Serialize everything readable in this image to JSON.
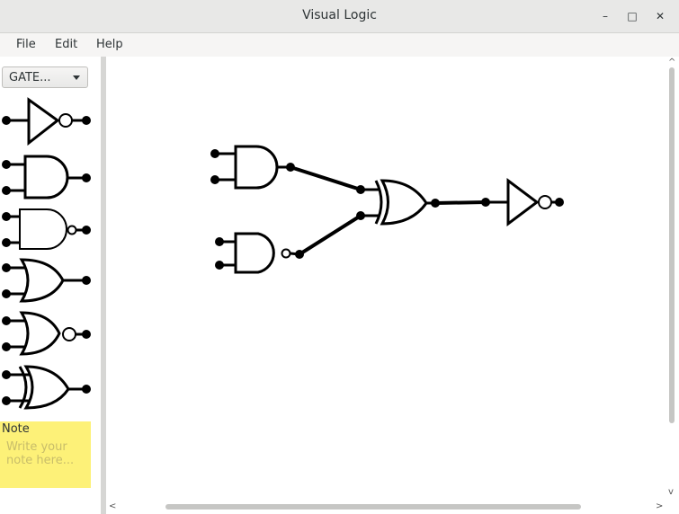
{
  "window": {
    "title": "Visual Logic",
    "minimize_glyph": "–",
    "maximize_glyph": "□",
    "close_glyph": "✕"
  },
  "menu": [
    "File",
    "Edit",
    "Help"
  ],
  "sidebar": {
    "gate_selector": "GATE...",
    "palette_icons": [
      "not-gate-icon",
      "and-gate-icon",
      "nand-gate-icon",
      "or-gate-icon",
      "nor-gate-icon",
      "xor-gate-icon"
    ]
  },
  "note": {
    "label": "Note",
    "placeholder": "Write your note here...",
    "value": "",
    "color": "#fdf178"
  },
  "scrollbars": {
    "up": "^",
    "down": "v",
    "left": "<",
    "right": ">"
  }
}
